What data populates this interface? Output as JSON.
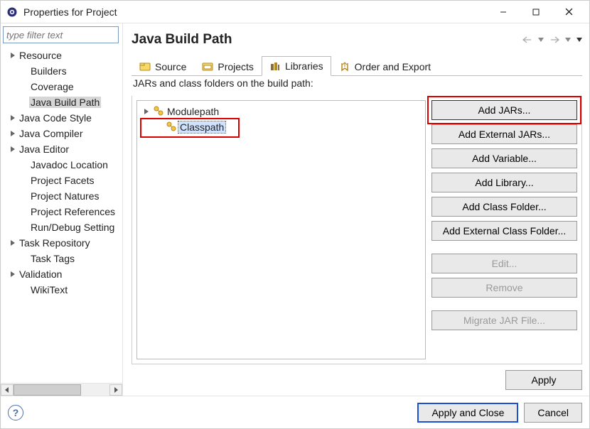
{
  "window": {
    "title": "Properties for Project"
  },
  "sidebar": {
    "filter_placeholder": "type filter text",
    "items": [
      {
        "label": "Resource",
        "expandable": true
      },
      {
        "label": "Builders",
        "expandable": false,
        "child": true
      },
      {
        "label": "Coverage",
        "expandable": false,
        "child": true
      },
      {
        "label": "Java Build Path",
        "expandable": false,
        "child": true,
        "selected": true
      },
      {
        "label": "Java Code Style",
        "expandable": true
      },
      {
        "label": "Java Compiler",
        "expandable": true
      },
      {
        "label": "Java Editor",
        "expandable": true
      },
      {
        "label": "Javadoc Location",
        "expandable": false,
        "child": true
      },
      {
        "label": "Project Facets",
        "expandable": false,
        "child": true
      },
      {
        "label": "Project Natures",
        "expandable": false,
        "child": true
      },
      {
        "label": "Project References",
        "expandable": false,
        "child": true
      },
      {
        "label": "Run/Debug Setting",
        "expandable": false,
        "child": true
      },
      {
        "label": "Task Repository",
        "expandable": true
      },
      {
        "label": "Task Tags",
        "expandable": false,
        "child": true
      },
      {
        "label": "Validation",
        "expandable": true
      },
      {
        "label": "WikiText",
        "expandable": false,
        "child": true
      }
    ]
  },
  "main": {
    "heading": "Java Build Path",
    "tabs": [
      {
        "label": "Source"
      },
      {
        "label": "Projects"
      },
      {
        "label": "Libraries",
        "active": true
      },
      {
        "label": "Order and Export"
      }
    ],
    "description": "JARs and class folders on the build path:",
    "tree": [
      {
        "label": "Modulepath",
        "expandable": true
      },
      {
        "label": "Classpath",
        "expandable": false,
        "child": true,
        "selected": true
      }
    ],
    "buttons": {
      "add_jars": "Add JARs...",
      "add_external_jars": "Add External JARs...",
      "add_variable": "Add Variable...",
      "add_library": "Add Library...",
      "add_class_folder": "Add Class Folder...",
      "add_external_class_folder": "Add External Class Folder...",
      "edit": "Edit...",
      "remove": "Remove",
      "migrate": "Migrate JAR File...",
      "apply": "Apply"
    }
  },
  "footer": {
    "apply_close": "Apply and Close",
    "cancel": "Cancel"
  },
  "highlights": {
    "classpath_box": true,
    "add_jars_box": true
  }
}
